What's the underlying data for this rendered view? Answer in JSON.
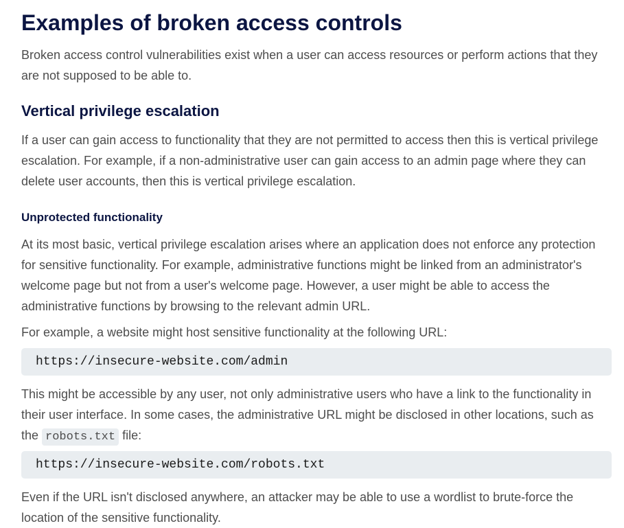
{
  "article": {
    "title": "Examples of broken access controls",
    "intro": "Broken access control vulnerabilities exist when a user can access resources or perform actions that they are not supposed to be able to.",
    "section_vertical": {
      "heading": "Vertical privilege escalation",
      "paragraph": "If a user can gain access to functionality that they are not permitted to access then this is vertical privilege escalation. For example, if a non-administrative user can gain access to an admin page where they can delete user accounts, then this is vertical privilege escalation."
    },
    "section_unprotected": {
      "heading": "Unprotected functionality",
      "paragraph1": "At its most basic, vertical privilege escalation arises where an application does not enforce any protection for sensitive functionality. For example, administrative functions might be linked from an administrator's welcome page but not from a user's welcome page. However, a user might be able to access the administrative functions by browsing to the relevant admin URL.",
      "paragraph2": "For example, a website might host sensitive functionality at the following URL:",
      "code1": "https://insecure-website.com/admin",
      "paragraph3_before": "This might be accessible by any user, not only administrative users who have a link to the functionality in their user interface. In some cases, the administrative URL might be disclosed in other locations, such as the ",
      "paragraph3_code": "robots.txt",
      "paragraph3_after": " file:",
      "code2": "https://insecure-website.com/robots.txt",
      "paragraph4": "Even if the URL isn't disclosed anywhere, an attacker may be able to use a wordlist to brute-force the location of the sensitive functionality."
    }
  }
}
